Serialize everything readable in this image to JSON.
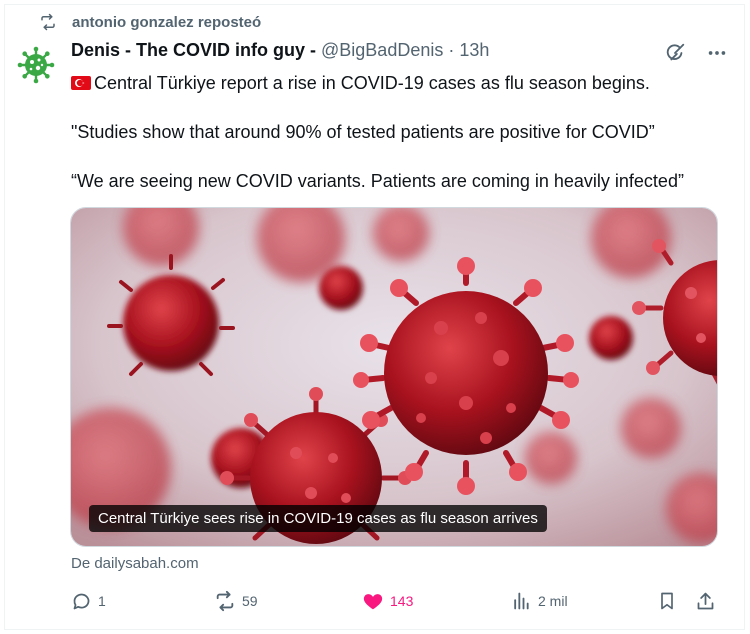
{
  "repost": {
    "text": "antonio gonzalez reposteó"
  },
  "author": {
    "name": "Denis - The COVID info guy -",
    "handle": "@BigBadDenis",
    "separator": "·",
    "time": "13h"
  },
  "post": {
    "flag_icon": "turkey-flag-icon",
    "paragraphs": [
      "Central Türkiye report a rise in COVID-19 cases as flu season begins.",
      "\"Studies show that around 90% of tested patients are positive for COVID”",
      "“We are seeing new COVID variants. Patients are coming in heavily infected”"
    ]
  },
  "media": {
    "caption": "Central Türkiye sees rise in COVID-19 cases as flu season arrives"
  },
  "source": {
    "text": "De dailysabah.com"
  },
  "actions": {
    "reply_count": "1",
    "repost_count": "59",
    "like_count": "143",
    "views_count": "2 mil"
  },
  "colors": {
    "like": "#f91880",
    "muted": "#536471",
    "text": "#0f1419"
  }
}
